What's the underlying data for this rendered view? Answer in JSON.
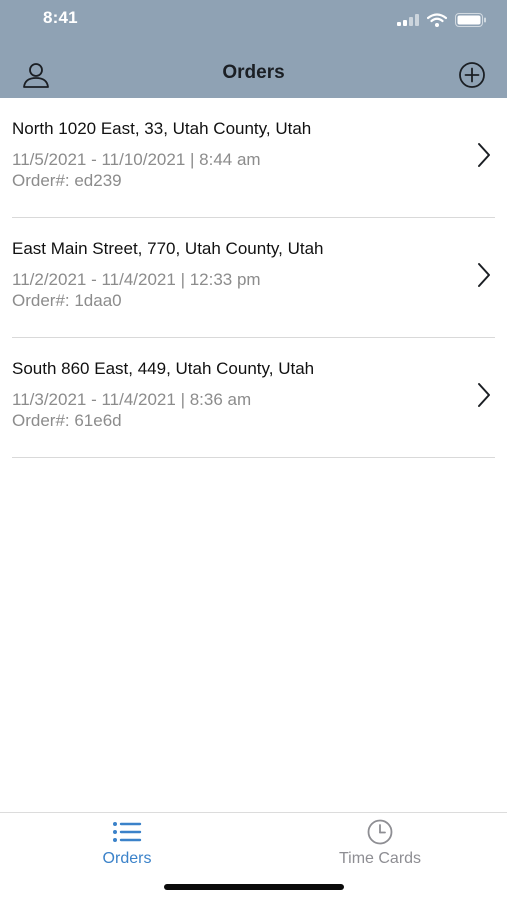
{
  "status_bar": {
    "time": "8:41"
  },
  "nav": {
    "title": "Orders",
    "left_icon": "person-icon",
    "right_icon": "plus-circle-icon"
  },
  "orders": [
    {
      "address": "North 1020 East, 33, Utah County, Utah",
      "dates": "11/5/2021 - 11/10/2021 | 8:44 am",
      "order_no": "Order#: ed239"
    },
    {
      "address": "East Main Street, 770, Utah County, Utah",
      "dates": "11/2/2021 - 11/4/2021 | 12:33 pm",
      "order_no": "Order#: 1daa0"
    },
    {
      "address": "South 860 East, 449, Utah County, Utah",
      "dates": "11/3/2021 - 11/4/2021 | 8:36 am",
      "order_no": "Order#: 61e6d"
    }
  ],
  "tabbar": {
    "tabs": [
      {
        "label": "Orders",
        "icon": "list-icon",
        "selected": true
      },
      {
        "label": "Time Cards",
        "icon": "clock-icon",
        "selected": false
      }
    ]
  },
  "colors": {
    "nav_background": "#8fa2b4",
    "accent": "#3b82c9",
    "secondary_text": "#8c8c8c"
  }
}
